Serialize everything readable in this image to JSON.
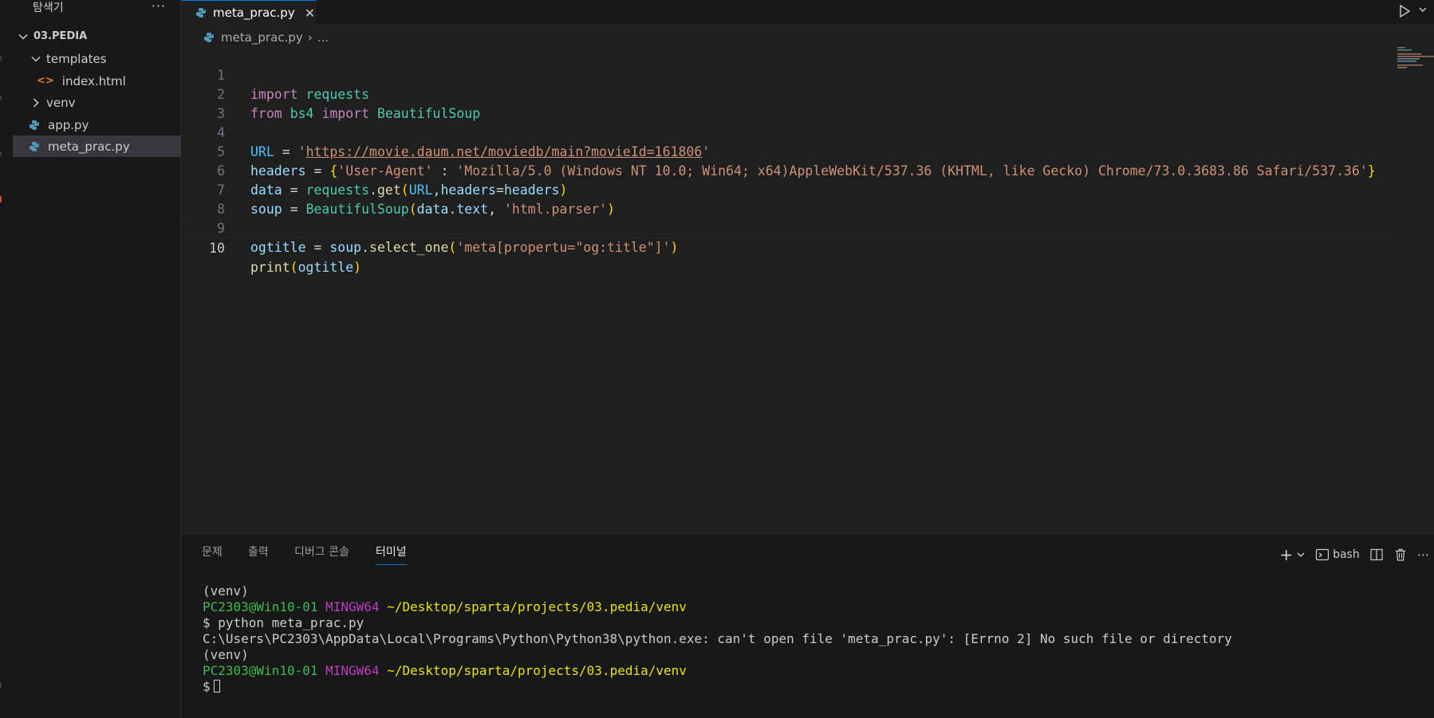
{
  "sidebar": {
    "title": "탐색기",
    "more": "···",
    "root": "03.PEDIA",
    "items": [
      {
        "label": "templates"
      },
      {
        "label": "index.html"
      },
      {
        "label": "venv"
      },
      {
        "label": "app.py"
      },
      {
        "label": "meta_prac.py"
      }
    ]
  },
  "tab": {
    "label": "meta_prac.py",
    "close": "✕"
  },
  "breadcrumb": {
    "file": "meta_prac.py",
    "sep": "›",
    "rest": "..."
  },
  "editor": {
    "line_numbers": [
      "1",
      "2",
      "3",
      "4",
      "5",
      "6",
      "7",
      "8",
      "9",
      "10"
    ],
    "l1": {
      "a": "import",
      "b": "requests"
    },
    "l2": {
      "a": "from",
      "b": "bs4",
      "c": "import",
      "d": "BeautifulSoup"
    },
    "l4": {
      "a": "URL",
      "b": "=",
      "c": "'",
      "d": "https://movie.daum.net/moviedb/main?movieId=161806",
      "e": "'"
    },
    "l5": {
      "a": "headers",
      "b": "=",
      "c": "{",
      "d": "'User-Agent'",
      "e": ":",
      "f": "'Mozilla/5.0 (Windows NT 10.0; Win64; x64)AppleWebKit/537.36 (KHTML, like Gecko) Chrome/73.0.3683.86 Safari/537.36'",
      "g": "}"
    },
    "l6": {
      "a": "data",
      "b": "=",
      "c": "requests",
      "d": ".",
      "e": "get",
      "f": "(",
      "g": "URL",
      "h": ",",
      "i": "headers",
      "j": "=",
      "k": "headers",
      "l": ")"
    },
    "l7": {
      "a": "soup",
      "b": "=",
      "c": "BeautifulSoup",
      "d": "(",
      "e": "data",
      "f": ".",
      "g": "text",
      "h": ",",
      "i": "'html.parser'",
      "j": ")"
    },
    "l9": {
      "a": "ogtitle",
      "b": "=",
      "c": "soup",
      "d": ".",
      "e": "select_one",
      "f": "(",
      "g": "'meta[propertu=\"og:title\"]'",
      "h": ")"
    },
    "l10": {
      "a": "print",
      "b": "(",
      "c": "ogtitle",
      "d": ")"
    }
  },
  "panel": {
    "tabs": [
      "문제",
      "출력",
      "디버그 콘솔",
      "터미널"
    ],
    "shell": "bash",
    "plus": "+",
    "more": "···"
  },
  "terminal": {
    "l1": "(venv)",
    "l2a": "PC2303@Win10-01",
    "l2b": "MINGW64",
    "l2c": "~/Desktop/sparta/projects/03.pedia/venv",
    "l3": "$ python meta_prac.py",
    "l4": "C:\\Users\\PC2303\\AppData\\Local\\Programs\\Python\\Python38\\python.exe: can't open file 'meta_prac.py': [Errno 2] No such file or directory",
    "l5": "(venv)",
    "l6a": "PC2303@Win10-01",
    "l6b": "MINGW64",
    "l6c": "~/Desktop/sparta/projects/03.pedia/venv",
    "l7": "$"
  },
  "colors": {
    "accent": "#0078d4",
    "background": "#1f1f1f",
    "sidebar": "#181818"
  }
}
